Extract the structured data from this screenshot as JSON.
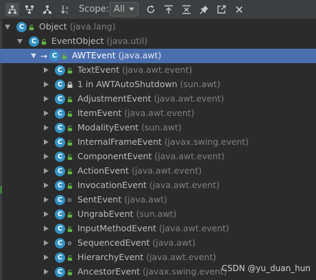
{
  "toolbar": {
    "scope_label": "Scope:",
    "scope_value": "All",
    "buttons": [
      {
        "name": "subtypes-hierarchy-icon"
      },
      {
        "name": "supertypes-hierarchy-icon"
      },
      {
        "name": "class-hierarchy-icon"
      },
      {
        "name": "sort-alphabetically-icon"
      },
      {
        "name": "refresh-icon"
      },
      {
        "name": "autoscroll-icon"
      },
      {
        "name": "collapse-all-icon"
      },
      {
        "name": "pin-icon"
      },
      {
        "name": "export-icon"
      },
      {
        "name": "close-icon"
      }
    ]
  },
  "tree": [
    {
      "name": "Object",
      "package": "(java.lang)",
      "level": 0,
      "expanded": true
    },
    {
      "name": "EventObject",
      "package": "(java.util)",
      "level": 1,
      "expanded": true
    },
    {
      "name": "AWTEvent",
      "package": "(java.awt)",
      "level": 2,
      "expanded": true,
      "selected": true
    },
    {
      "name": "TextEvent",
      "package": "(java.awt.event)",
      "level": 3
    },
    {
      "name": "1 in AWTAutoShutdown",
      "package": "(sun.awt)",
      "level": 3
    },
    {
      "name": "AdjustmentEvent",
      "package": "(java.awt.event)",
      "level": 3
    },
    {
      "name": "ItemEvent",
      "package": "(java.awt.event)",
      "level": 3
    },
    {
      "name": "ModalityEvent",
      "package": "(sun.awt)",
      "level": 3
    },
    {
      "name": "InternalFrameEvent",
      "package": "(javax.swing.event)",
      "level": 3
    },
    {
      "name": "ComponentEvent",
      "package": "(java.awt.event)",
      "level": 3
    },
    {
      "name": "ActionEvent",
      "package": "(java.awt.event)",
      "level": 3
    },
    {
      "name": "InvocationEvent",
      "package": "(java.awt.event)",
      "level": 3
    },
    {
      "name": "SentEvent",
      "package": "(java.awt)",
      "level": 3
    },
    {
      "name": "UngrabEvent",
      "package": "(sun.awt)",
      "level": 3
    },
    {
      "name": "InputMethodEvent",
      "package": "(java.awt.event)",
      "level": 3
    },
    {
      "name": "SequencedEvent",
      "package": "(java.awt)",
      "level": 3
    },
    {
      "name": "HierarchyEvent",
      "package": "(java.awt.event)",
      "level": 3
    },
    {
      "name": "AncestorEvent",
      "package": "(javax.swing.event)",
      "level": 3
    }
  ],
  "watermark": "CSDN @yu_duan_hun",
  "colors": {
    "background": "#2b2b2b",
    "toolbar": "#3c3f41",
    "selection": "#4b6eaf",
    "class_icon": "#3592c4",
    "public_green": "#62b543"
  }
}
